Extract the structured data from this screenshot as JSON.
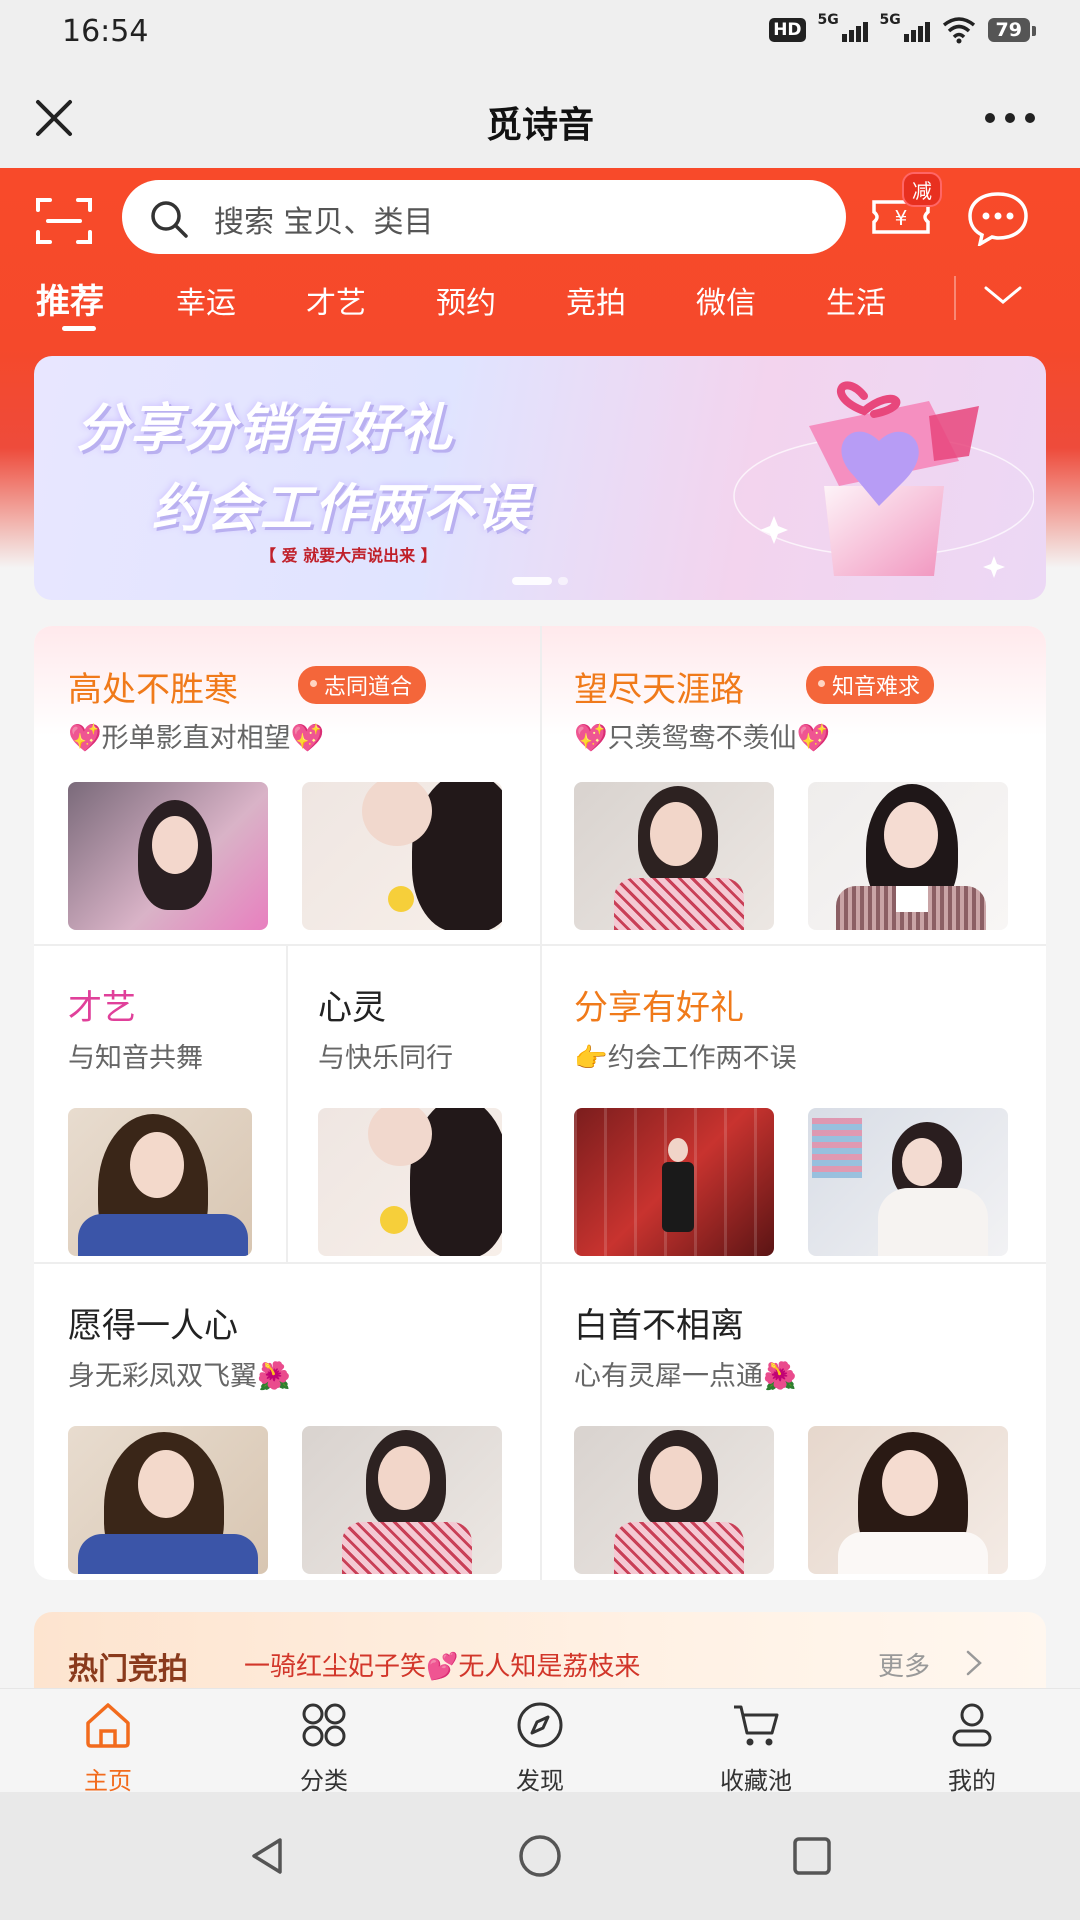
{
  "status_bar": {
    "time": "16:54",
    "hd": "HD",
    "net1": "5G",
    "net2": "5G",
    "battery": "79"
  },
  "title_bar": {
    "title": "觅诗音"
  },
  "search": {
    "placeholder": "搜索 宝贝、类目",
    "coupon_badge": "减"
  },
  "tabs": [
    {
      "label": "推荐"
    },
    {
      "label": "幸运"
    },
    {
      "label": "才艺"
    },
    {
      "label": "预约"
    },
    {
      "label": "竞拍"
    },
    {
      "label": "微信"
    },
    {
      "label": "生活"
    }
  ],
  "banner": {
    "line1": "分享分销有好礼",
    "line2": "约会工作两不误",
    "line3": "【 爱 就要大声说出来 】"
  },
  "cards": {
    "c1": {
      "title": "高处不胜寒",
      "tag": "志同道合",
      "subtitle": "💖形单影直对相望💖"
    },
    "c2": {
      "title": "望尽天涯路",
      "tag": "知音难求",
      "subtitle": "💖只羡鸳鸯不羡仙💖"
    },
    "c3": {
      "title": "才艺",
      "subtitle": "与知音共舞",
      "title_color": "#e0409a"
    },
    "c4": {
      "title": "心灵",
      "subtitle": "与快乐同行"
    },
    "c5": {
      "title": "分享有好礼",
      "subtitle": "👉约会工作两不误",
      "title_color": "#f07a1a"
    },
    "c6": {
      "title": "愿得一人心",
      "subtitle": "身无彩凤双飞翼🌺"
    },
    "c7": {
      "title": "白首不相离",
      "subtitle": "心有灵犀一点通🌺"
    },
    "title_color_orange": "#f07a1a"
  },
  "hot": {
    "title": "热门竞拍",
    "text": "一骑红尘妃子笑💕无人知是荔枝来",
    "more": "更多"
  },
  "bottom_nav": [
    {
      "label": "主页",
      "icon": "home-icon",
      "active": true
    },
    {
      "label": "分类",
      "icon": "category-icon"
    },
    {
      "label": "发现",
      "icon": "compass-icon"
    },
    {
      "label": "收藏池",
      "icon": "cart-icon"
    },
    {
      "label": "我的",
      "icon": "user-icon"
    }
  ],
  "colors": {
    "brand_red": "#f84a2a",
    "accent_orange": "#f26b1d"
  }
}
